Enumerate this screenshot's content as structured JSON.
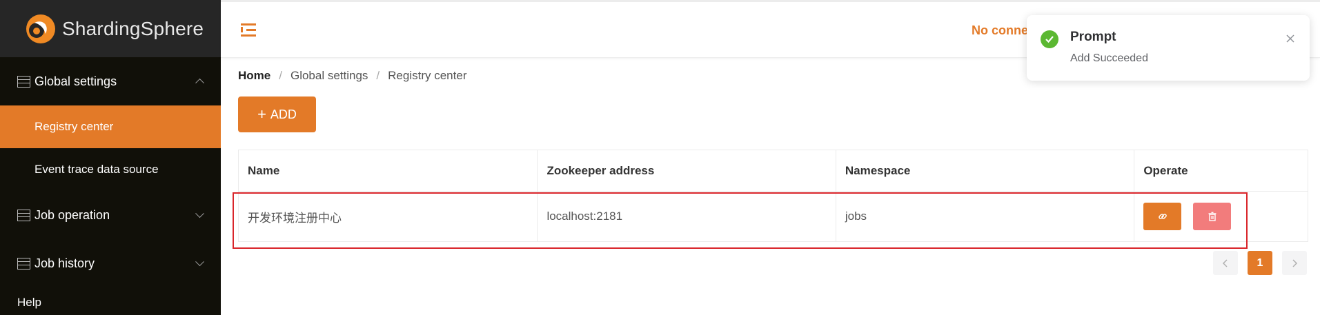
{
  "app": {
    "name": "ShardingSphere"
  },
  "sidebar": {
    "groups": [
      {
        "label": "Global settings",
        "expanded": true
      },
      {
        "label": "Job operation",
        "expanded": false
      },
      {
        "label": "Job history",
        "expanded": false
      },
      {
        "label": "Help"
      }
    ],
    "global_items": [
      {
        "label": "Registry center",
        "active": true
      },
      {
        "label": "Event trace data source",
        "active": false
      }
    ]
  },
  "header": {
    "connection_status": "No conne"
  },
  "breadcrumb": {
    "home": "Home",
    "level1": "Global settings",
    "level2": "Registry center",
    "separator": "/"
  },
  "toolbar": {
    "add_label": "ADD"
  },
  "table": {
    "columns": [
      "Name",
      "Zookeeper address",
      "Namespace",
      "Operate"
    ],
    "rows": [
      {
        "name": "开发环境注册中心",
        "zookeeper_address": "localhost:2181",
        "namespace": "jobs"
      }
    ]
  },
  "pagination": {
    "current_page": "1"
  },
  "notification": {
    "title": "Prompt",
    "message": "Add Succeeded",
    "type": "success"
  },
  "colors": {
    "accent": "#e37a28",
    "sidebar_bg": "#111009",
    "danger": "#f27c7c",
    "success": "#5bb832",
    "highlight": "#d9252a"
  },
  "icons": [
    "shardingsphere-logo-icon",
    "menu-list-icon",
    "chevron-up-icon",
    "chevron-down-icon",
    "collapse-menu-icon",
    "plus-icon",
    "link-icon",
    "trash-icon",
    "chevron-left-icon",
    "chevron-right-icon",
    "success-check-icon",
    "close-icon"
  ]
}
